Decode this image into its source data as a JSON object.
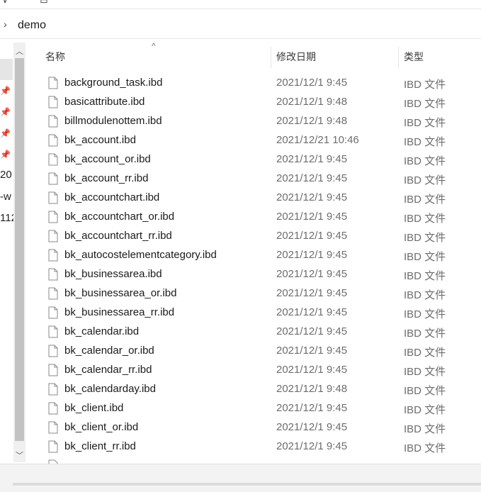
{
  "address_bar": {
    "crumb": "demo"
  },
  "columns": {
    "name": "名称",
    "modified": "修改日期",
    "type": "类型"
  },
  "left_pane_fragments": [
    "20",
    "-w",
    "112"
  ],
  "files": [
    {
      "name": "background_task.ibd",
      "date": "2021/12/1 9:45",
      "type": "IBD 文件"
    },
    {
      "name": "basicattribute.ibd",
      "date": "2021/12/1 9:48",
      "type": "IBD 文件"
    },
    {
      "name": "billmodulenottem.ibd",
      "date": "2021/12/1 9:48",
      "type": "IBD 文件"
    },
    {
      "name": "bk_account.ibd",
      "date": "2021/12/21 10:46",
      "type": "IBD 文件"
    },
    {
      "name": "bk_account_or.ibd",
      "date": "2021/12/1 9:45",
      "type": "IBD 文件"
    },
    {
      "name": "bk_account_rr.ibd",
      "date": "2021/12/1 9:45",
      "type": "IBD 文件"
    },
    {
      "name": "bk_accountchart.ibd",
      "date": "2021/12/1 9:45",
      "type": "IBD 文件"
    },
    {
      "name": "bk_accountchart_or.ibd",
      "date": "2021/12/1 9:45",
      "type": "IBD 文件"
    },
    {
      "name": "bk_accountchart_rr.ibd",
      "date": "2021/12/1 9:45",
      "type": "IBD 文件"
    },
    {
      "name": "bk_autocostelementcategory.ibd",
      "date": "2021/12/1 9:45",
      "type": "IBD 文件"
    },
    {
      "name": "bk_businessarea.ibd",
      "date": "2021/12/1 9:45",
      "type": "IBD 文件"
    },
    {
      "name": "bk_businessarea_or.ibd",
      "date": "2021/12/1 9:45",
      "type": "IBD 文件"
    },
    {
      "name": "bk_businessarea_rr.ibd",
      "date": "2021/12/1 9:45",
      "type": "IBD 文件"
    },
    {
      "name": "bk_calendar.ibd",
      "date": "2021/12/1 9:45",
      "type": "IBD 文件"
    },
    {
      "name": "bk_calendar_or.ibd",
      "date": "2021/12/1 9:45",
      "type": "IBD 文件"
    },
    {
      "name": "bk_calendar_rr.ibd",
      "date": "2021/12/1 9:45",
      "type": "IBD 文件"
    },
    {
      "name": "bk_calendarday.ibd",
      "date": "2021/12/1 9:48",
      "type": "IBD 文件"
    },
    {
      "name": "bk_client.ibd",
      "date": "2021/12/1 9:45",
      "type": "IBD 文件"
    },
    {
      "name": "bk_client_or.ibd",
      "date": "2021/12/1 9:45",
      "type": "IBD 文件"
    },
    {
      "name": "bk_client_rr.ibd",
      "date": "2021/12/1 9:45",
      "type": "IBD 文件"
    }
  ]
}
